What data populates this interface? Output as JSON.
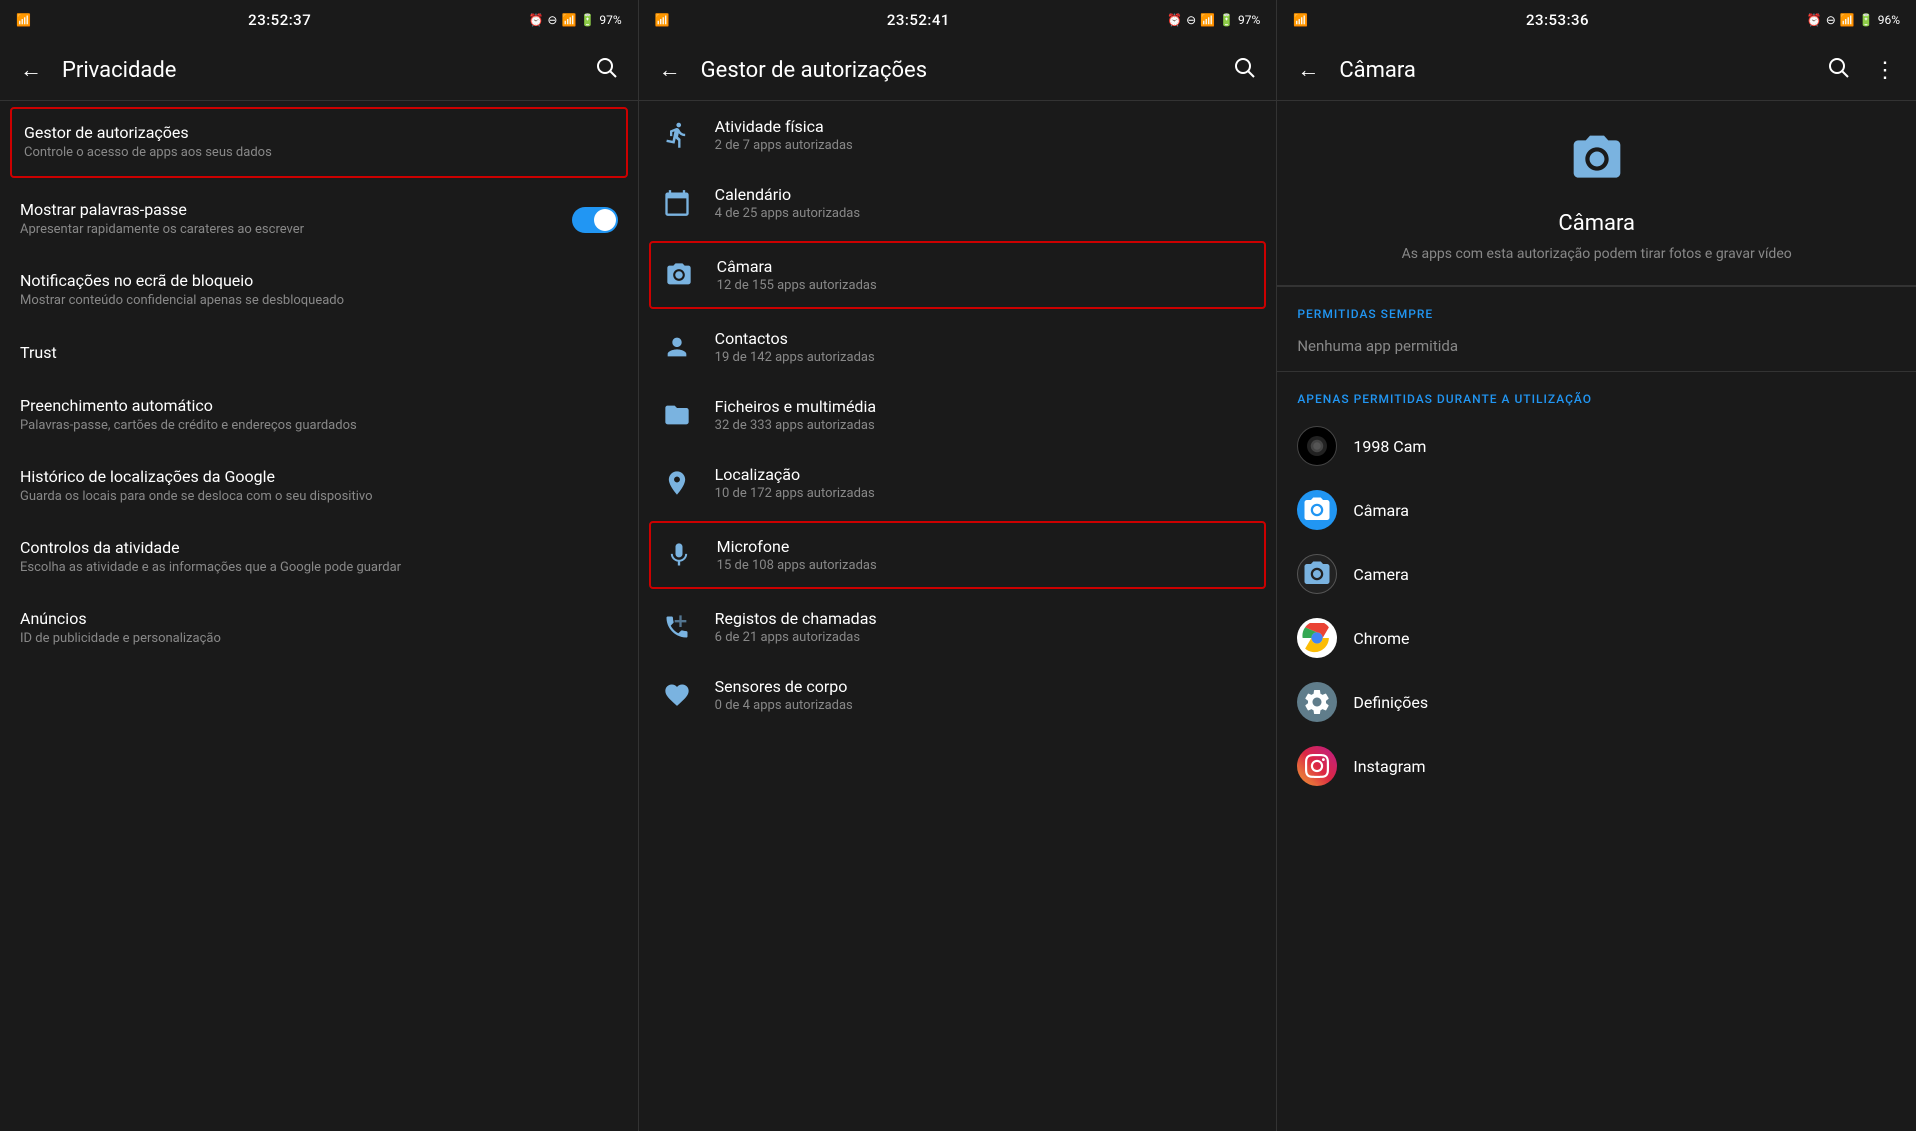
{
  "panels": [
    {
      "id": "privacidade",
      "status": {
        "left_icon": "signal",
        "time": "23:52:37",
        "right_icons": [
          "alarm",
          "dnd",
          "wifi",
          "network",
          "battery"
        ],
        "battery": "97%"
      },
      "topBar": {
        "back_label": "←",
        "title": "Privacidade",
        "search_label": "🔍"
      },
      "items": [
        {
          "id": "gestor-autorizacoes",
          "title": "Gestor de autorizações",
          "subtitle": "Controle o acesso de apps aos seus dados",
          "highlighted": true,
          "hasToggle": false
        },
        {
          "id": "mostrar-palavras-passe",
          "title": "Mostrar palavras-passe",
          "subtitle": "Apresentar rapidamente os carateres ao escrever",
          "highlighted": false,
          "hasToggle": true
        },
        {
          "id": "notificacoes-ecra",
          "title": "Notificações no ecrã de bloqueio",
          "subtitle": "Mostrar conteúdo confidencial apenas se desbloqueado",
          "highlighted": false,
          "hasToggle": false
        },
        {
          "id": "trust",
          "title": "Trust",
          "subtitle": "",
          "highlighted": false,
          "hasToggle": false
        },
        {
          "id": "preenchimento",
          "title": "Preenchimento automático",
          "subtitle": "Palavras-passe, cartões de crédito e endereços guardados",
          "highlighted": false,
          "hasToggle": false
        },
        {
          "id": "historico-google",
          "title": "Histórico de localizações da Google",
          "subtitle": "Guarda os locais para onde se desloca com o seu dispositivo",
          "highlighted": false,
          "hasToggle": false
        },
        {
          "id": "controlos-atividade",
          "title": "Controlos da atividade",
          "subtitle": "Escolha as atividade e as informações que a Google pode guardar",
          "highlighted": false,
          "hasToggle": false
        },
        {
          "id": "anuncios",
          "title": "Anúncios",
          "subtitle": "ID de publicidade e personalização",
          "highlighted": false,
          "hasToggle": false
        }
      ]
    },
    {
      "id": "gestor-autorizacoes",
      "status": {
        "time": "23:52:41",
        "battery": "97%"
      },
      "topBar": {
        "back_label": "←",
        "title": "Gestor de autorizações",
        "search_label": "🔍"
      },
      "items": [
        {
          "id": "atividade-fisica",
          "icon": "walk",
          "title": "Atividade física",
          "subtitle": "2 de 7 apps autorizadas",
          "highlighted": false
        },
        {
          "id": "calendario",
          "icon": "calendar",
          "title": "Calendário",
          "subtitle": "4 de 25 apps autorizadas",
          "highlighted": false
        },
        {
          "id": "camara",
          "icon": "camera",
          "title": "Câmara",
          "subtitle": "12 de 155 apps autorizadas",
          "highlighted": true
        },
        {
          "id": "contactos",
          "icon": "person",
          "title": "Contactos",
          "subtitle": "19 de 142 apps autorizadas",
          "highlighted": false
        },
        {
          "id": "ficheiros",
          "icon": "folder",
          "title": "Ficheiros e multimédia",
          "subtitle": "32 de 333 apps autorizadas",
          "highlighted": false
        },
        {
          "id": "localizacao",
          "icon": "location",
          "title": "Localização",
          "subtitle": "10 de 172 apps autorizadas",
          "highlighted": false
        },
        {
          "id": "microfone",
          "icon": "mic",
          "title": "Microfone",
          "subtitle": "15 de 108 apps autorizadas",
          "highlighted": true
        },
        {
          "id": "registos-chamadas",
          "icon": "phone",
          "title": "Registos de chamadas",
          "subtitle": "6 de 21 apps autorizadas",
          "highlighted": false
        },
        {
          "id": "sensores-corpo",
          "icon": "heart",
          "title": "Sensores de corpo",
          "subtitle": "0 de 4 apps autorizadas",
          "highlighted": false
        }
      ]
    },
    {
      "id": "camara-detail",
      "status": {
        "time": "23:53:36",
        "battery": "96%"
      },
      "topBar": {
        "back_label": "←",
        "title": "Câmara",
        "search_label": "🔍",
        "more_label": "⋮"
      },
      "header": {
        "icon": "camera",
        "title": "Câmara",
        "subtitle": "As apps com esta autorização podem tirar fotos e gravar vídeo"
      },
      "sections": [
        {
          "id": "permitidas-sempre",
          "label": "PERMITIDAS SEMPRE",
          "empty_text": "Nenhuma app permitida",
          "apps": []
        },
        {
          "id": "apenas-durante-utilizacao",
          "label": "APENAS PERMITIDAS DURANTE A UTILIZAÇÃO",
          "apps": [
            {
              "id": "1998cam",
              "name": "1998 Cam",
              "icon_type": "1998cam"
            },
            {
              "id": "camara-app",
              "name": "Câmara",
              "icon_type": "camara"
            },
            {
              "id": "camera-app",
              "name": "Camera",
              "icon_type": "camera"
            },
            {
              "id": "chrome",
              "name": "Chrome",
              "icon_type": "chrome"
            },
            {
              "id": "definicoes",
              "name": "Definições",
              "icon_type": "definicoes"
            },
            {
              "id": "instagram",
              "name": "Instagram",
              "icon_type": "instagram"
            }
          ]
        }
      ]
    }
  ]
}
